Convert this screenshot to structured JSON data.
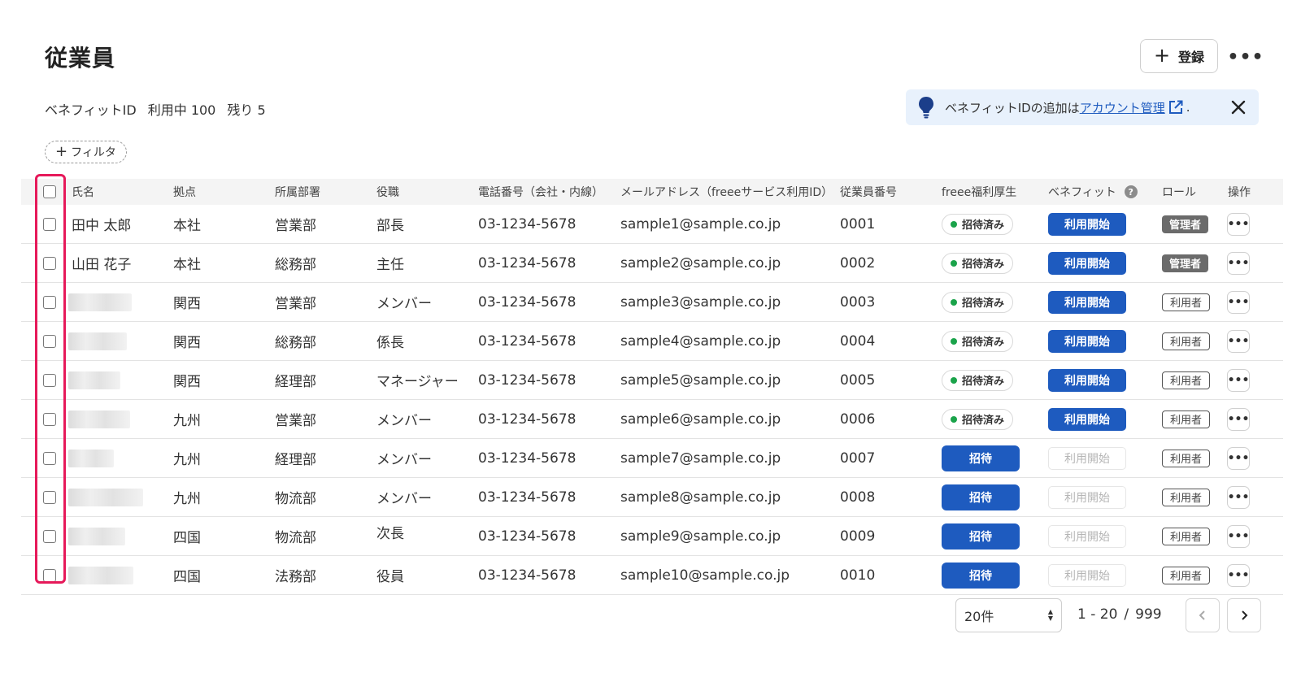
{
  "header": {
    "title": "従業員",
    "register_label": "登録",
    "more_label": "•••"
  },
  "summary": {
    "label": "ベネフィットID",
    "in_use": "利用中 100",
    "remaining": "残り 5"
  },
  "notice": {
    "text_before": "ベネフィットIDの追加は",
    "link": "アカウント管理",
    "text_after": "."
  },
  "filter": {
    "label": "フィルタ"
  },
  "columns": {
    "name": "氏名",
    "location": "拠点",
    "department": "所属部署",
    "position": "役職",
    "phone": "電話番号（会社・内線）",
    "email": "メールアドレス（freeeサービス利用ID）",
    "employee_no": "従業員番号",
    "welfare": "freee福利厚生",
    "benefit": "ベネフィット",
    "role": "ロール",
    "actions": "操作"
  },
  "rows": [
    {
      "name": "田中 太郎",
      "location": "本社",
      "department": "営業部",
      "position": "部長",
      "phone": "03-1234-5678",
      "email": "sample1@sample.co.jp",
      "employee_no": "0001",
      "status": "招待済み",
      "benefit": "利用開始",
      "role": "管理者"
    },
    {
      "name": "山田 花子",
      "location": "本社",
      "department": "総務部",
      "position": "主任",
      "phone": "03-1234-5678",
      "email": "sample2@sample.co.jp",
      "employee_no": "0002",
      "status": "招待済み",
      "benefit": "利用開始",
      "role": "管理者"
    },
    {
      "name": "",
      "location": "関西",
      "department": "営業部",
      "position": "メンバー",
      "phone": "03-1234-5678",
      "email": "sample3@sample.co.jp",
      "employee_no": "0003",
      "status": "招待済み",
      "benefit": "利用開始",
      "role": "利用者"
    },
    {
      "name": "",
      "location": "関西",
      "department": "総務部",
      "position": "係長",
      "phone": "03-1234-5678",
      "email": "sample4@sample.co.jp",
      "employee_no": "0004",
      "status": "招待済み",
      "benefit": "利用開始",
      "role": "利用者"
    },
    {
      "name": "",
      "location": "関西",
      "department": "経理部",
      "position": "マネージャー",
      "phone": "03-1234-5678",
      "email": "sample5@sample.co.jp",
      "employee_no": "0005",
      "status": "招待済み",
      "benefit": "利用開始",
      "role": "利用者"
    },
    {
      "name": "",
      "location": "九州",
      "department": "営業部",
      "position": "メンバー",
      "phone": "03-1234-5678",
      "email": "sample6@sample.co.jp",
      "employee_no": "0006",
      "status": "招待済み",
      "benefit": "利用開始",
      "role": "利用者"
    },
    {
      "name": "",
      "location": "九州",
      "department": "経理部",
      "position": "メンバー",
      "phone": "03-1234-5678",
      "email": "sample7@sample.co.jp",
      "employee_no": "0007",
      "status": "招待",
      "benefit": "利用開始",
      "role": "利用者"
    },
    {
      "name": "",
      "location": "九州",
      "department": "物流部",
      "position": "メンバー",
      "phone": "03-1234-5678",
      "email": "sample8@sample.co.jp",
      "employee_no": "0008",
      "status": "招待",
      "benefit": "利用開始",
      "role": "利用者"
    },
    {
      "name": "",
      "location": "四国",
      "department": "物流部",
      "position": "次長",
      "phone": "03-1234-5678",
      "email": "sample9@sample.co.jp",
      "employee_no": "0009",
      "status": "招待",
      "benefit": "利用開始",
      "role": "利用者"
    },
    {
      "name": "",
      "location": "四国",
      "department": "法務部",
      "position": "役員",
      "phone": "03-1234-5678",
      "email": "sample10@sample.co.jp",
      "employee_no": "0010",
      "status": "招待",
      "benefit": "利用開始",
      "role": "利用者"
    }
  ],
  "pagination": {
    "per_page": "20件",
    "range": "1 - 20",
    "separator": "/",
    "total": "999"
  },
  "colors": {
    "primary": "#1e5bbf",
    "success": "#1aa34a",
    "highlight": "#e6195a",
    "admin_badge": "#6b6b6b"
  }
}
